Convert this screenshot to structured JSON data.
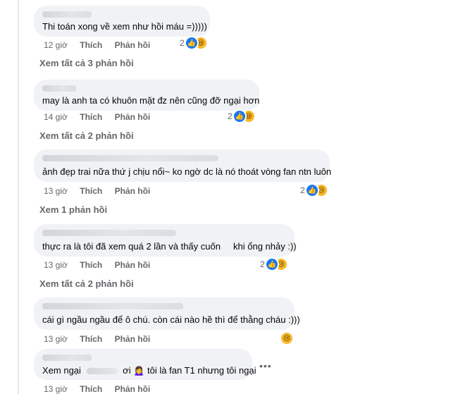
{
  "comments": [
    {
      "text": "Thi toán xong về xem như hồi máu =)))))",
      "time": "12 giờ",
      "like": "Thích",
      "reply": "Phản hồi",
      "reaction_count": "2",
      "reactions": [
        "like-icon",
        "haha-icon"
      ],
      "view_replies": "Xem tất cả 3 phản hồi"
    },
    {
      "text": "may là anh ta có khuôn mặt đz nên cũng đỡ ngại hơn",
      "time": "14 giờ",
      "like": "Thích",
      "reply": "Phản hồi",
      "reaction_count": "2",
      "reactions": [
        "like-icon",
        "haha-icon"
      ],
      "view_replies": "Xem tất cả 2 phản hồi"
    },
    {
      "text": "ảnh đẹp trai nữa thứ j chịu nổi~ ko ngờ dc là nó thoát vòng fan ntn luôn",
      "time": "13 giờ",
      "like": "Thích",
      "reply": "Phản hồi",
      "reaction_count": "2",
      "reactions": [
        "like-icon",
        "sad-icon"
      ],
      "view_replies": "Xem 1 phản hồi"
    },
    {
      "text": "thực ra là tôi đã xem quá 2 lần và thấy cuốn     khi ổng nhảy :))",
      "time": "13 giờ",
      "like": "Thích",
      "reply": "Phản hồi",
      "reaction_count": "2",
      "reactions": [
        "like-icon",
        "sad-icon"
      ],
      "view_replies": "Xem tất cả 2 phản hồi"
    },
    {
      "text": "cái gì ngầu ngầu để ô chú. còn cái nào hề thì để thằng cháu :)))",
      "time": "13 giờ",
      "like": "Thích",
      "reply": "Phản hồi",
      "reaction_count": "",
      "reactions": [
        "sad-icon"
      ]
    },
    {
      "text_a": "Xem ngại",
      "text_b": "ơi",
      "text_c": "tôi là fan T1 nhưng tôi ngại",
      "time": "13 giờ",
      "like": "Thích",
      "reply": "Phản hồi",
      "more": "•••"
    }
  ],
  "colors": {
    "bubble": "#f0f2f5",
    "meta": "#65676b",
    "like": "#1877f2",
    "emoji": "#f7b928"
  }
}
